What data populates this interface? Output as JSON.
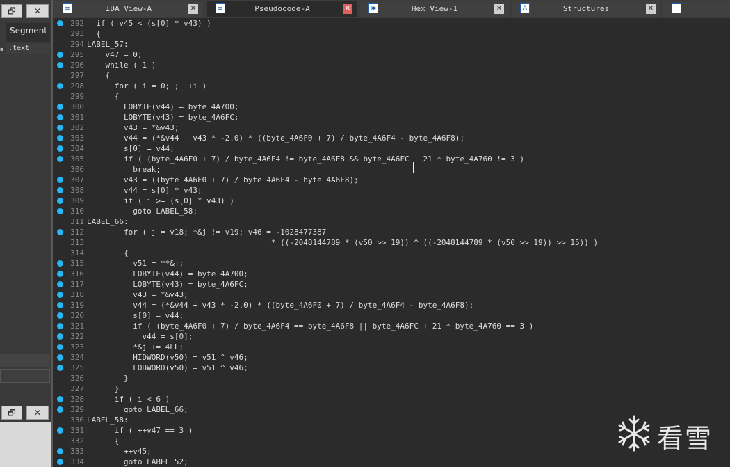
{
  "window_buttons": [
    "🗗",
    "✕"
  ],
  "left_panel": {
    "header": "Segment",
    "row": ".text",
    "marker": "▪"
  },
  "tabs": [
    {
      "label": "IDA View-A",
      "icon": "ida-view-icon",
      "glyph": "≣",
      "active": false
    },
    {
      "label": "Pseudocode-A",
      "icon": "pseudocode-icon",
      "glyph": "≣",
      "active": true
    },
    {
      "label": "Hex View-1",
      "icon": "hex-view-icon",
      "glyph": "◉",
      "active": false
    },
    {
      "label": "Structures",
      "icon": "structures-icon",
      "glyph": "A",
      "active": false
    }
  ],
  "tab_close_glyph": "✕",
  "code_lines": [
    {
      "num": "292",
      "bp": true,
      "text": "  if ( v45 < (s[0] * v43) )"
    },
    {
      "num": "293",
      "bp": false,
      "text": "  {"
    },
    {
      "num": "294",
      "bp": false,
      "text": "LABEL_57:"
    },
    {
      "num": "295",
      "bp": true,
      "text": "    v47 = 0;"
    },
    {
      "num": "296",
      "bp": true,
      "text": "    while ( 1 )"
    },
    {
      "num": "297",
      "bp": false,
      "text": "    {"
    },
    {
      "num": "298",
      "bp": true,
      "text": "      for ( i = 0; ; ++i )"
    },
    {
      "num": "299",
      "bp": false,
      "text": "      {"
    },
    {
      "num": "300",
      "bp": true,
      "text": "        LOBYTE(v44) = byte_4A700;"
    },
    {
      "num": "301",
      "bp": true,
      "text": "        LOBYTE(v43) = byte_4A6FC;"
    },
    {
      "num": "302",
      "bp": true,
      "text": "        v43 = *&v43;"
    },
    {
      "num": "303",
      "bp": true,
      "text": "        v44 = (*&v44 + v43 * -2.0) * ((byte_4A6F0 + 7) / byte_4A6F4 - byte_4A6F8);"
    },
    {
      "num": "304",
      "bp": true,
      "text": "        s[0] = v44;"
    },
    {
      "num": "305",
      "bp": true,
      "text": "        if ( (byte_4A6F0 + 7) / byte_4A6F4 != byte_4A6F8 && byte_4A6FC + 21 * byte_4A760 != 3 )"
    },
    {
      "num": "306",
      "bp": false,
      "text": "          break;"
    },
    {
      "num": "307",
      "bp": true,
      "text": "        v43 = ((byte_4A6F0 + 7) / byte_4A6F4 - byte_4A6F8);"
    },
    {
      "num": "308",
      "bp": true,
      "text": "        v44 = s[0] * v43;"
    },
    {
      "num": "309",
      "bp": true,
      "text": "        if ( i >= (s[0] * v43) )"
    },
    {
      "num": "310",
      "bp": true,
      "text": "          goto LABEL_58;"
    },
    {
      "num": "311",
      "bp": false,
      "text": "LABEL_66:"
    },
    {
      "num": "312",
      "bp": true,
      "text": "        for ( j = v18; *&j != v19; v46 = -1028477387"
    },
    {
      "num": "313",
      "bp": false,
      "text": "                                        * ((-2048144789 * (v50 >> 19)) ^ ((-2048144789 * (v50 >> 19)) >> 15)) )"
    },
    {
      "num": "314",
      "bp": false,
      "text": "        {"
    },
    {
      "num": "315",
      "bp": true,
      "text": "          v51 = **&j;"
    },
    {
      "num": "316",
      "bp": true,
      "text": "          LOBYTE(v44) = byte_4A700;"
    },
    {
      "num": "317",
      "bp": true,
      "text": "          LOBYTE(v43) = byte_4A6FC;"
    },
    {
      "num": "318",
      "bp": true,
      "text": "          v43 = *&v43;"
    },
    {
      "num": "319",
      "bp": true,
      "text": "          v44 = (*&v44 + v43 * -2.0) * ((byte_4A6F0 + 7) / byte_4A6F4 - byte_4A6F8);"
    },
    {
      "num": "320",
      "bp": true,
      "text": "          s[0] = v44;"
    },
    {
      "num": "321",
      "bp": true,
      "text": "          if ( (byte_4A6F0 + 7) / byte_4A6F4 == byte_4A6F8 || byte_4A6FC + 21 * byte_4A760 == 3 )"
    },
    {
      "num": "322",
      "bp": true,
      "text": "            v44 = s[0];"
    },
    {
      "num": "323",
      "bp": true,
      "text": "          *&j += 4LL;"
    },
    {
      "num": "324",
      "bp": true,
      "text": "          HIDWORD(v50) = v51 ^ v46;"
    },
    {
      "num": "325",
      "bp": true,
      "text": "          LODWORD(v50) = v51 ^ v46;"
    },
    {
      "num": "326",
      "bp": false,
      "text": "        }"
    },
    {
      "num": "327",
      "bp": false,
      "text": "      }"
    },
    {
      "num": "328",
      "bp": true,
      "text": "      if ( i < 6 )"
    },
    {
      "num": "329",
      "bp": true,
      "text": "        goto LABEL_66;"
    },
    {
      "num": "330",
      "bp": false,
      "text": "LABEL_58:"
    },
    {
      "num": "331",
      "bp": true,
      "text": "      if ( ++v47 == 3 )"
    },
    {
      "num": "332",
      "bp": false,
      "text": "      {"
    },
    {
      "num": "333",
      "bp": true,
      "text": "        ++v45;"
    },
    {
      "num": "334",
      "bp": true,
      "text": "        goto LABEL_52;"
    }
  ],
  "watermark": {
    "logo": "snowflake-icon",
    "text": "看雪"
  },
  "colors": {
    "background": "#2b2b2b",
    "breakpoint": "#29b6f6",
    "line_number": "#8a8a8a",
    "code_text": "#dcdcdc"
  }
}
